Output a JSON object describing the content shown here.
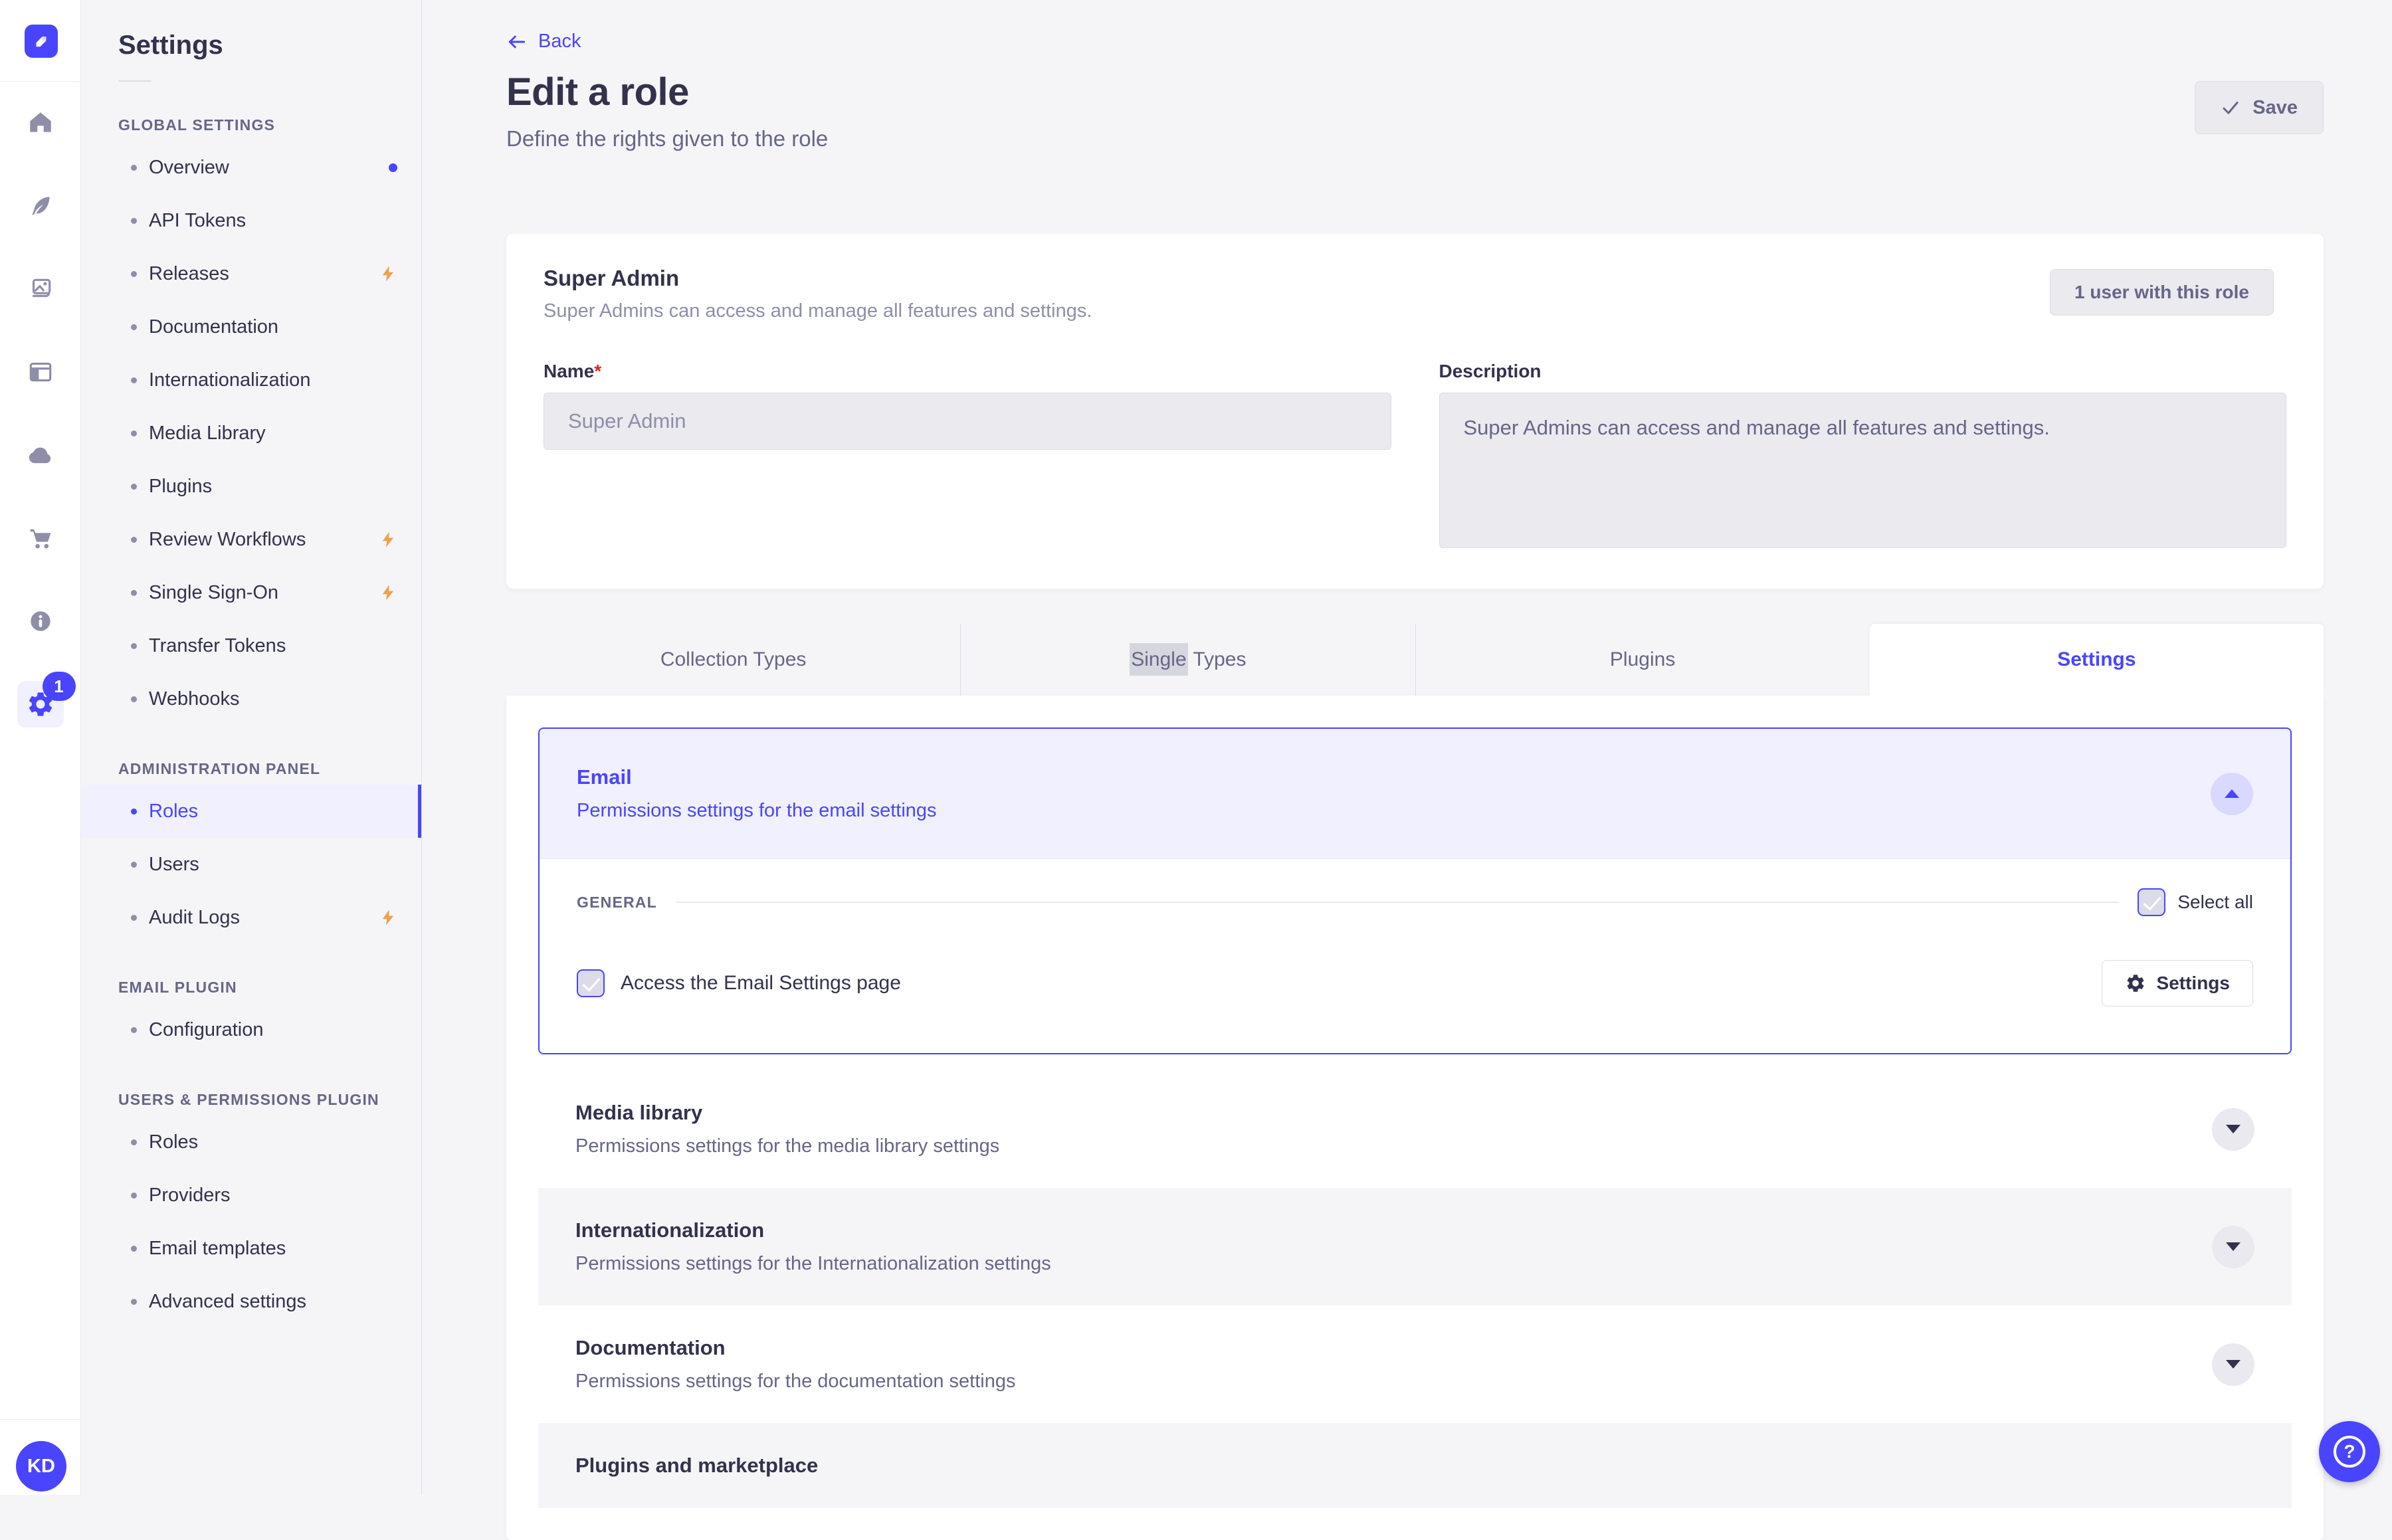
{
  "app": {
    "accent": "#4945FF",
    "accent_light": "#F0F0FF",
    "text_dark": "#32324D",
    "text_gray": "#666687",
    "border": "#DCDCE4",
    "page_bg": "#F5F5F8",
    "lightning_color": "#F0A04B"
  },
  "rail": {
    "badge_count": "1",
    "avatar_initials": "KD"
  },
  "subnav": {
    "title": "Settings",
    "sections": [
      {
        "label": "GLOBAL SETTINGS",
        "items": [
          {
            "label": "Overview"
          },
          {
            "label": "API Tokens"
          },
          {
            "label": "Releases"
          },
          {
            "label": "Documentation"
          },
          {
            "label": "Internationalization"
          },
          {
            "label": "Media Library"
          },
          {
            "label": "Plugins"
          },
          {
            "label": "Review Workflows"
          },
          {
            "label": "Single Sign-On"
          },
          {
            "label": "Transfer Tokens"
          },
          {
            "label": "Webhooks"
          }
        ]
      },
      {
        "label": "ADMINISTRATION PANEL",
        "items": [
          {
            "label": "Roles"
          },
          {
            "label": "Users"
          },
          {
            "label": "Audit Logs"
          }
        ]
      },
      {
        "label": "EMAIL PLUGIN",
        "items": [
          {
            "label": "Configuration"
          }
        ]
      },
      {
        "label": "USERS & PERMISSIONS PLUGIN",
        "items": [
          {
            "label": "Roles"
          },
          {
            "label": "Providers"
          },
          {
            "label": "Email templates"
          },
          {
            "label": "Advanced settings"
          }
        ]
      }
    ]
  },
  "header": {
    "back_label": "Back",
    "title": "Edit a role",
    "subtitle": "Define the rights given to the role",
    "save_label": "Save"
  },
  "role_card": {
    "title": "Super Admin",
    "subtitle": "Super Admins can access and manage all features and settings.",
    "users_button_label": "1 user with this role",
    "name_label": "Name",
    "required_mark": "*",
    "name_value": "Super Admin",
    "description_label": "Description",
    "description_value": "Super Admins can access and manage all features and settings."
  },
  "tabs": {
    "collection_types": "Collection Types",
    "single_types_selected_word": "Single",
    "single_types_rest": " Types",
    "plugins": "Plugins",
    "settings": "Settings",
    "active_tab": "Settings"
  },
  "permissions": {
    "email": {
      "title": "Email",
      "description": "Permissions settings for the email settings",
      "section_label": "GENERAL",
      "select_all_label": "Select all",
      "select_all_checked": true,
      "permission_label": "Access the Email Settings page",
      "permission_checked": true,
      "settings_button_label": "Settings"
    },
    "accordions": [
      {
        "title": "Media library",
        "description": "Permissions settings for the media library settings"
      },
      {
        "title": "Internationalization",
        "description": "Permissions settings for the Internationalization settings"
      },
      {
        "title": "Documentation",
        "description": "Permissions settings for the documentation settings"
      },
      {
        "title": "Plugins and marketplace",
        "description": ""
      }
    ]
  },
  "fab": {
    "help_glyph": "?"
  }
}
